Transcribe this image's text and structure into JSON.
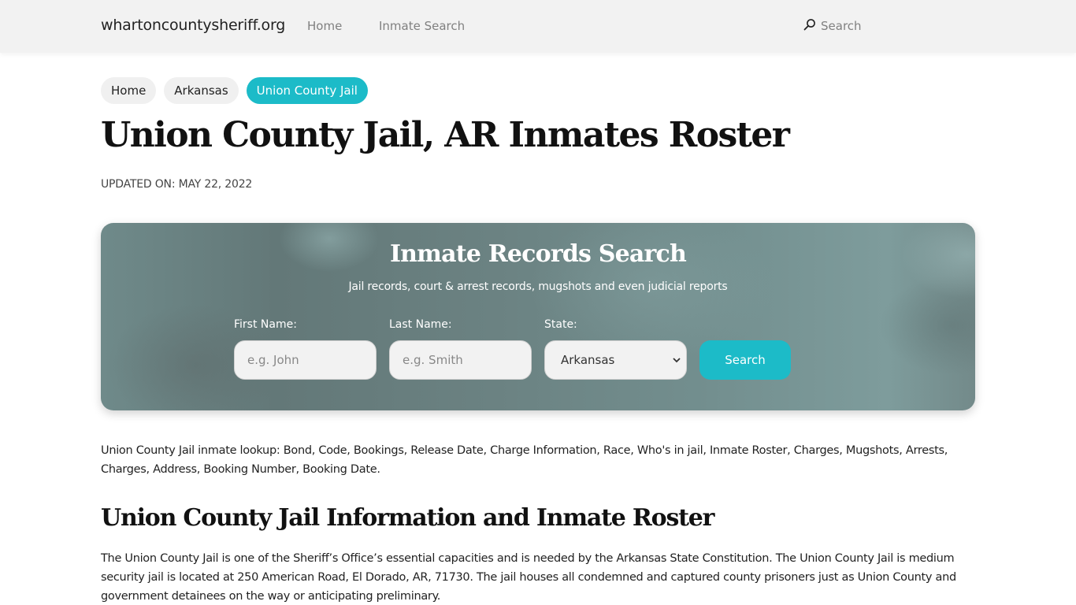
{
  "header": {
    "brand": "whartoncountysheriff.org",
    "nav": [
      {
        "label": "Home"
      },
      {
        "label": "Inmate Search"
      }
    ],
    "search_label": "Search",
    "search_icon": "search-icon"
  },
  "breadcrumb": [
    {
      "label": "Home",
      "active": false
    },
    {
      "label": "Arkansas",
      "active": false
    },
    {
      "label": "Union County Jail",
      "active": true
    }
  ],
  "page": {
    "title": "Union County Jail, AR Inmates Roster",
    "updated": "UPDATED ON: MAY 22, 2022"
  },
  "search_card": {
    "title": "Inmate Records Search",
    "subtitle": "Jail records, court & arrest records, mugshots and even judicial reports",
    "first_name": {
      "label": "First Name:",
      "placeholder": "e.g. John",
      "value": ""
    },
    "last_name": {
      "label": "Last Name:",
      "placeholder": "e.g. Smith",
      "value": ""
    },
    "state": {
      "label": "State:",
      "selected": "Arkansas"
    },
    "button_label": "Search"
  },
  "content": {
    "intro": "Union County Jail inmate lookup: Bond, Code, Bookings, Release Date, Charge Information, Race, Who's in jail, Inmate Roster, Charges, Mugshots, Arrests, Charges, Address, Booking Number, Booking Date.",
    "section_title": "Union County Jail Information and Inmate Roster",
    "paragraph": "The Union County Jail is one of the Sheriff’s Office’s essential capacities and is needed by the Arkansas State Constitution. The Union County Jail is medium security jail is located at 250 American Road, El Dorado, AR, 71730. The jail houses all condemned and captured county prisoners just as Union County and government detainees on the way or anticipating preliminary."
  },
  "colors": {
    "accent": "#1cbbc8",
    "header_bg": "#f2f2f2",
    "card_bg": "#6b8282"
  }
}
